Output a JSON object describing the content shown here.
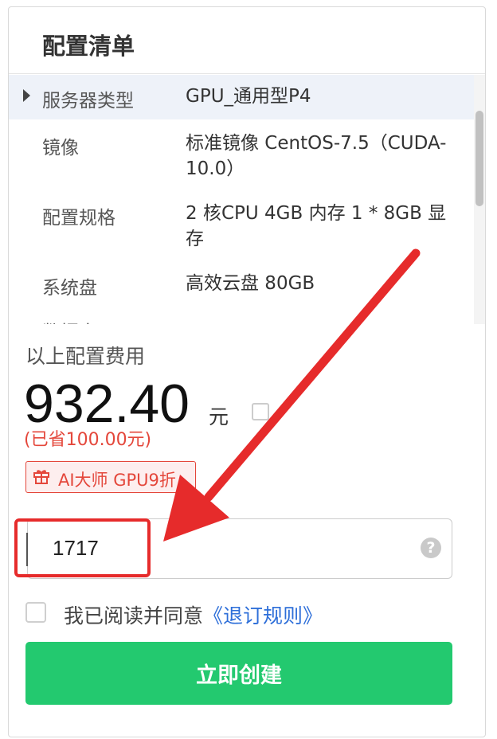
{
  "panel": {
    "title": "配置清单",
    "items": [
      {
        "label": "服务器类型",
        "value": "GPU_通用型P4",
        "active": true
      },
      {
        "label": "镜像",
        "value": "标准镜像 CentOS-7.5（CUDA-10.0）"
      },
      {
        "label": "配置规格",
        "value": "2 核CPU 4GB 内存 1 * 8GB 显存"
      },
      {
        "label": "系统盘",
        "value": "高效云盘 80GB"
      },
      {
        "label": "数据盘",
        "value": ""
      }
    ]
  },
  "cost": {
    "label": "以上配置费用",
    "price": "932.40",
    "unit": "元",
    "saved": "(已省100.00元)",
    "promo": "AI大师 GPU9折"
  },
  "input": {
    "value": "1717"
  },
  "agreement": {
    "text": "我已阅读并同意",
    "link": "《退订规则》",
    "checked": false
  },
  "create_button": {
    "label": "立即创建"
  },
  "colors": {
    "primary_green": "#23c96f",
    "discount_red": "#e4473b",
    "link_blue": "#2e6fd9",
    "annotation_red": "#e62b2b"
  }
}
